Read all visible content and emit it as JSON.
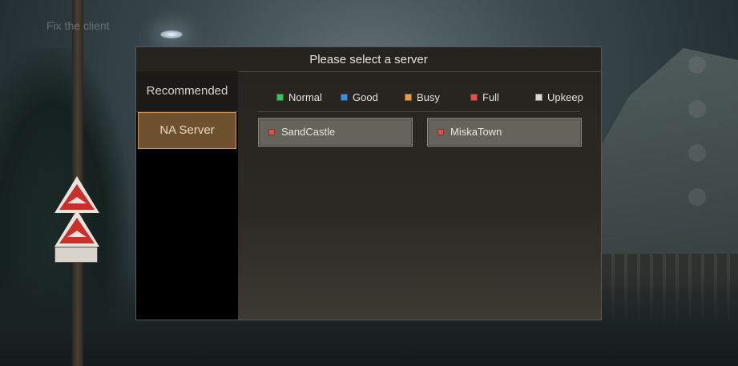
{
  "background": {
    "fix_client_text": "Fix the client"
  },
  "dialog": {
    "title": "Please select a server",
    "sidebar": {
      "header": "Recommended",
      "tabs": [
        {
          "label": "NA Server",
          "selected": true
        }
      ]
    },
    "legend": [
      {
        "label": "Normal",
        "color": "#3fbf5a"
      },
      {
        "label": "Good",
        "color": "#3a8fd6"
      },
      {
        "label": "Busy",
        "color": "#e0a04a"
      },
      {
        "label": "Full",
        "color": "#d9534f"
      },
      {
        "label": "Upkeep",
        "color": "#d9d9d9"
      }
    ],
    "servers": [
      {
        "name": "SandCastle",
        "status_color": "#d9534f"
      },
      {
        "name": "MiskaTown",
        "status_color": "#d9534f"
      }
    ]
  }
}
